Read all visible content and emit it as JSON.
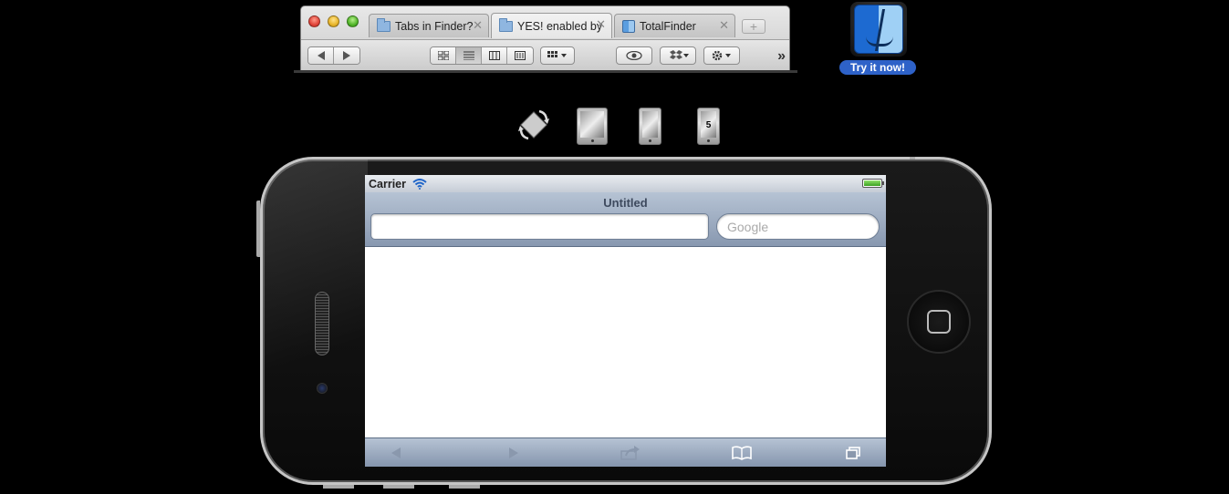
{
  "finder": {
    "tabs": [
      {
        "label": "Tabs in Finder?",
        "icon": "folder-icon",
        "close": "✕"
      },
      {
        "label": "YES! enabled by",
        "icon": "folder-icon",
        "close": "✕"
      },
      {
        "label": "TotalFinder",
        "icon": "finder-icon",
        "close": "✕"
      }
    ],
    "new_tab": "+",
    "overflow": "»"
  },
  "promo": {
    "label": "Try it now!"
  },
  "devices": {
    "iphone5_label": "5"
  },
  "phone": {
    "status": {
      "carrier": "Carrier"
    },
    "browser": {
      "title": "Untitled",
      "url_value": "",
      "search_placeholder": "Google"
    }
  },
  "colors": {
    "accent": "#2e62c8",
    "battery": "#3aa020"
  }
}
